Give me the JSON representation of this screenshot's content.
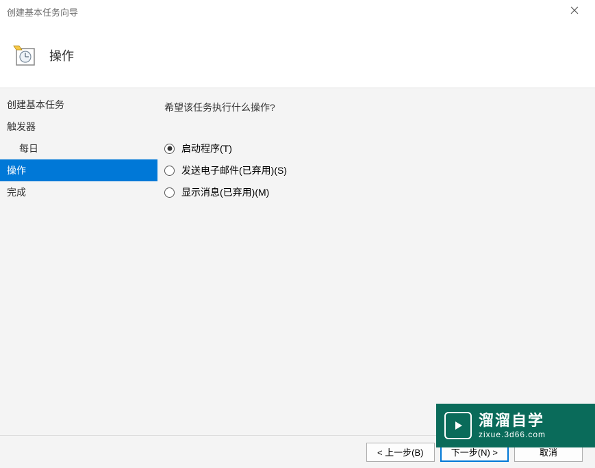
{
  "window": {
    "title": "创建基本任务向导"
  },
  "header": {
    "title": "操作"
  },
  "sidebar": {
    "items": [
      {
        "label": "创建基本任务",
        "active": false,
        "sub": false
      },
      {
        "label": "触发器",
        "active": false,
        "sub": false
      },
      {
        "label": "每日",
        "active": false,
        "sub": true
      },
      {
        "label": "操作",
        "active": true,
        "sub": false
      },
      {
        "label": "完成",
        "active": false,
        "sub": false
      }
    ]
  },
  "content": {
    "prompt": "希望该任务执行什么操作?",
    "radios": [
      {
        "label": "启动程序(T)",
        "checked": true
      },
      {
        "label": "发送电子邮件(已弃用)(S)",
        "checked": false
      },
      {
        "label": "显示消息(已弃用)(M)",
        "checked": false
      }
    ]
  },
  "footer": {
    "back": "< 上一步(B)",
    "next": "下一步(N) >",
    "cancel": "取消"
  },
  "watermark": {
    "line1": "溜溜自学",
    "line2": "zixue.3d66.com"
  }
}
